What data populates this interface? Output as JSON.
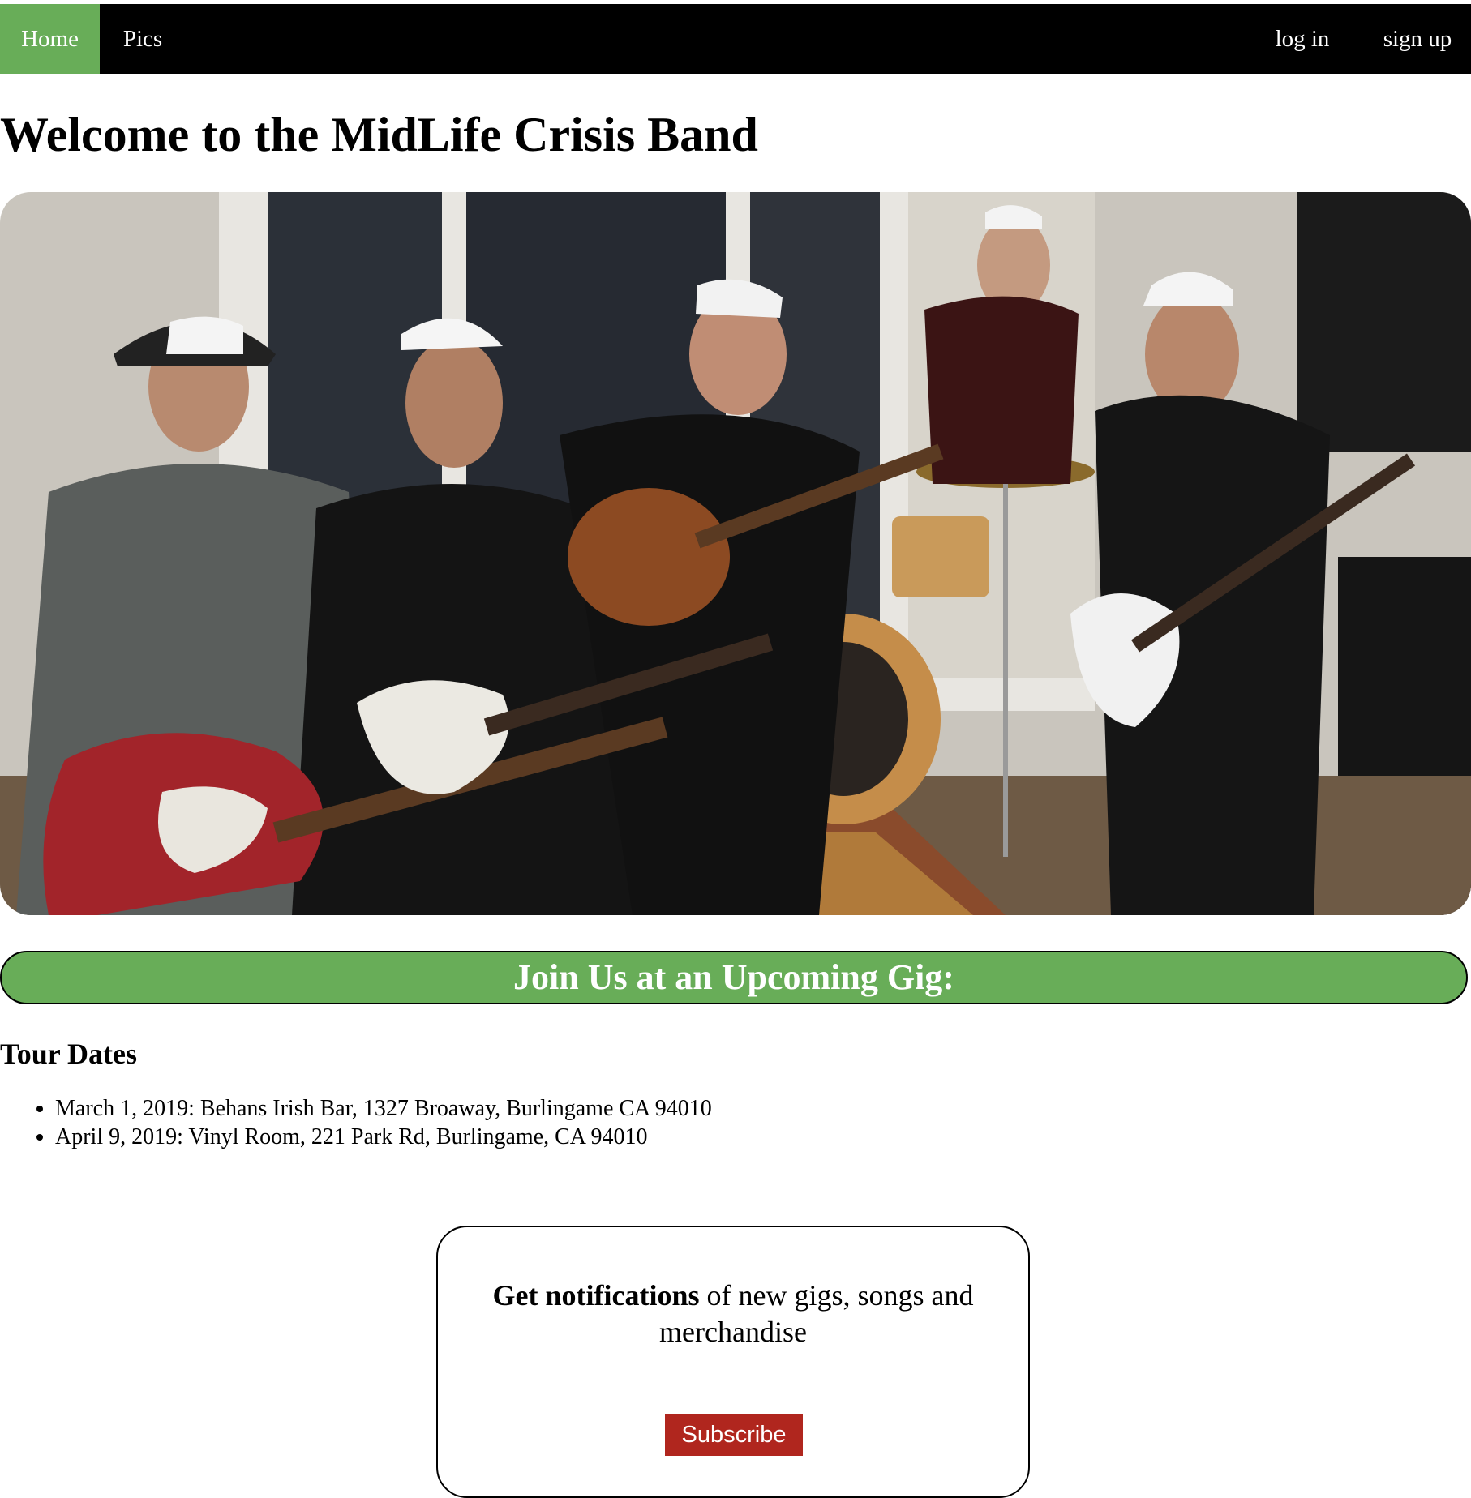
{
  "nav": {
    "home": "Home",
    "pics": "Pics",
    "login": "log in",
    "signup": "sign up",
    "active_color": "#68ad58"
  },
  "page": {
    "title": "Welcome to the MidLife Crisis Band"
  },
  "gig_banner": {
    "text": "Join Us at an Upcoming Gig:",
    "color": "#68ad58"
  },
  "tour": {
    "heading": "Tour Dates",
    "dates": [
      "March 1, 2019: Behans Irish Bar, 1327 Broaway, Burlingame CA 94010",
      "April 9, 2019: Vinyl Room, 221 Park Rd, Burlingame, CA 94010"
    ]
  },
  "notify": {
    "bold": "Get notifications",
    "rest": " of new gigs, songs and merchandise",
    "button": "Subscribe",
    "button_color": "#b0261e"
  }
}
